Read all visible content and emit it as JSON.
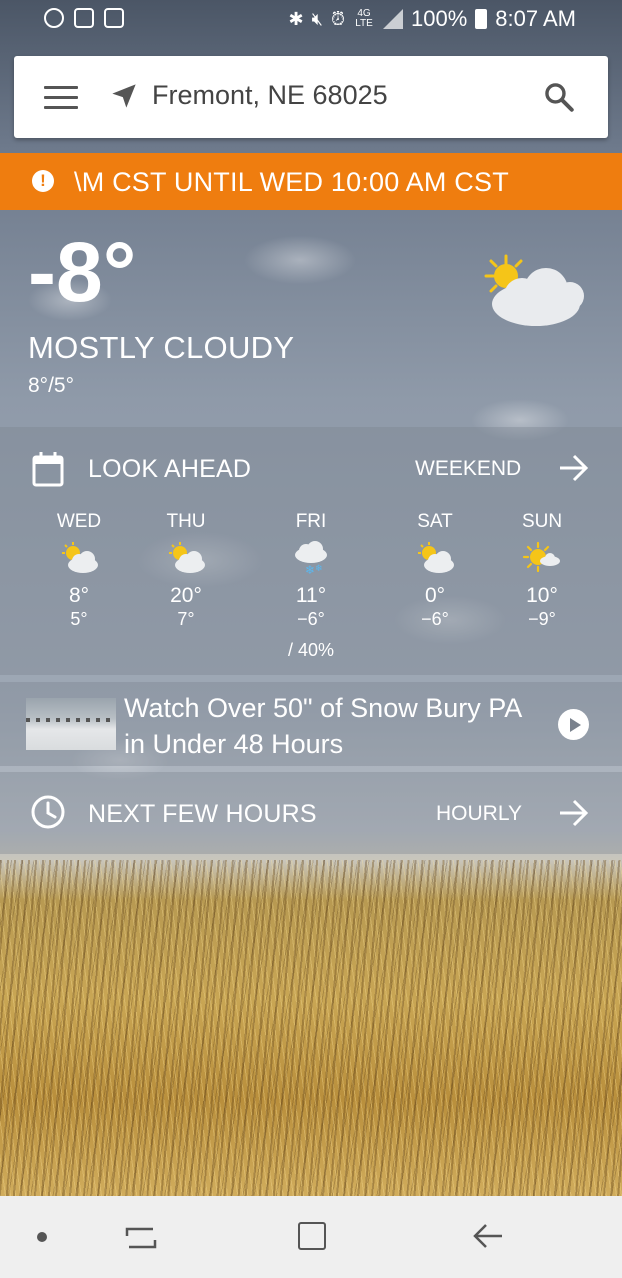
{
  "status_bar": {
    "network": "4G LTE",
    "battery": "100%",
    "time": "8:07 AM"
  },
  "search": {
    "location": "Fremont, NE 68025"
  },
  "alert": {
    "text": "\\M CST UNTIL WED 10:00 AM CST",
    "color": "#ef7d0f"
  },
  "current": {
    "temp": "-8°",
    "condition": "MOSTLY CLOUDY",
    "hilo": "8°/5°",
    "icon": "partly-cloudy-icon"
  },
  "look_ahead": {
    "title": "LOOK AHEAD",
    "link": "WEEKEND",
    "days": [
      {
        "name": "WED",
        "hi": "8°",
        "lo": "5°",
        "precip": "",
        "icon": "partly-cloudy-icon"
      },
      {
        "name": "THU",
        "hi": "20°",
        "lo": "7°",
        "precip": "",
        "icon": "partly-cloudy-icon"
      },
      {
        "name": "FRI",
        "hi": "11°",
        "lo": "−6°",
        "precip": "/ 40%",
        "icon": "snow-icon"
      },
      {
        "name": "SAT",
        "hi": "0°",
        "lo": "−6°",
        "precip": "",
        "icon": "partly-cloudy-icon"
      },
      {
        "name": "SUN",
        "hi": "10°",
        "lo": "−9°",
        "precip": "",
        "icon": "mostly-sunny-icon"
      }
    ]
  },
  "video": {
    "title": "Watch Over 50\" of Snow Bury PA in Under 48 Hours"
  },
  "next_hours": {
    "title": "NEXT FEW HOURS",
    "link": "HOURLY"
  }
}
